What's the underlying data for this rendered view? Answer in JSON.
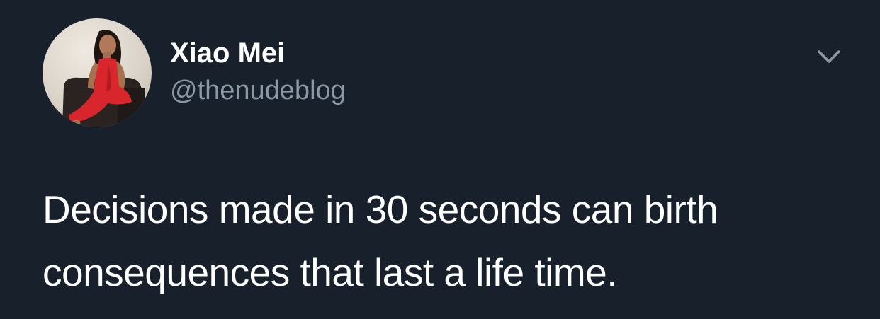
{
  "tweet": {
    "author": {
      "display_name": "Xiao Mei",
      "handle": "@thenudeblog",
      "avatar": "profile-photo"
    },
    "menu_icon": "chevron-down-icon",
    "text_lines": [
      "Decisions made in 30 seconds can birth",
      "consequences that last a life time."
    ]
  },
  "colors": {
    "background": "#17202b",
    "text_primary": "#ffffff",
    "text_secondary": "#8b98a5",
    "icon": "#8b98a5"
  }
}
